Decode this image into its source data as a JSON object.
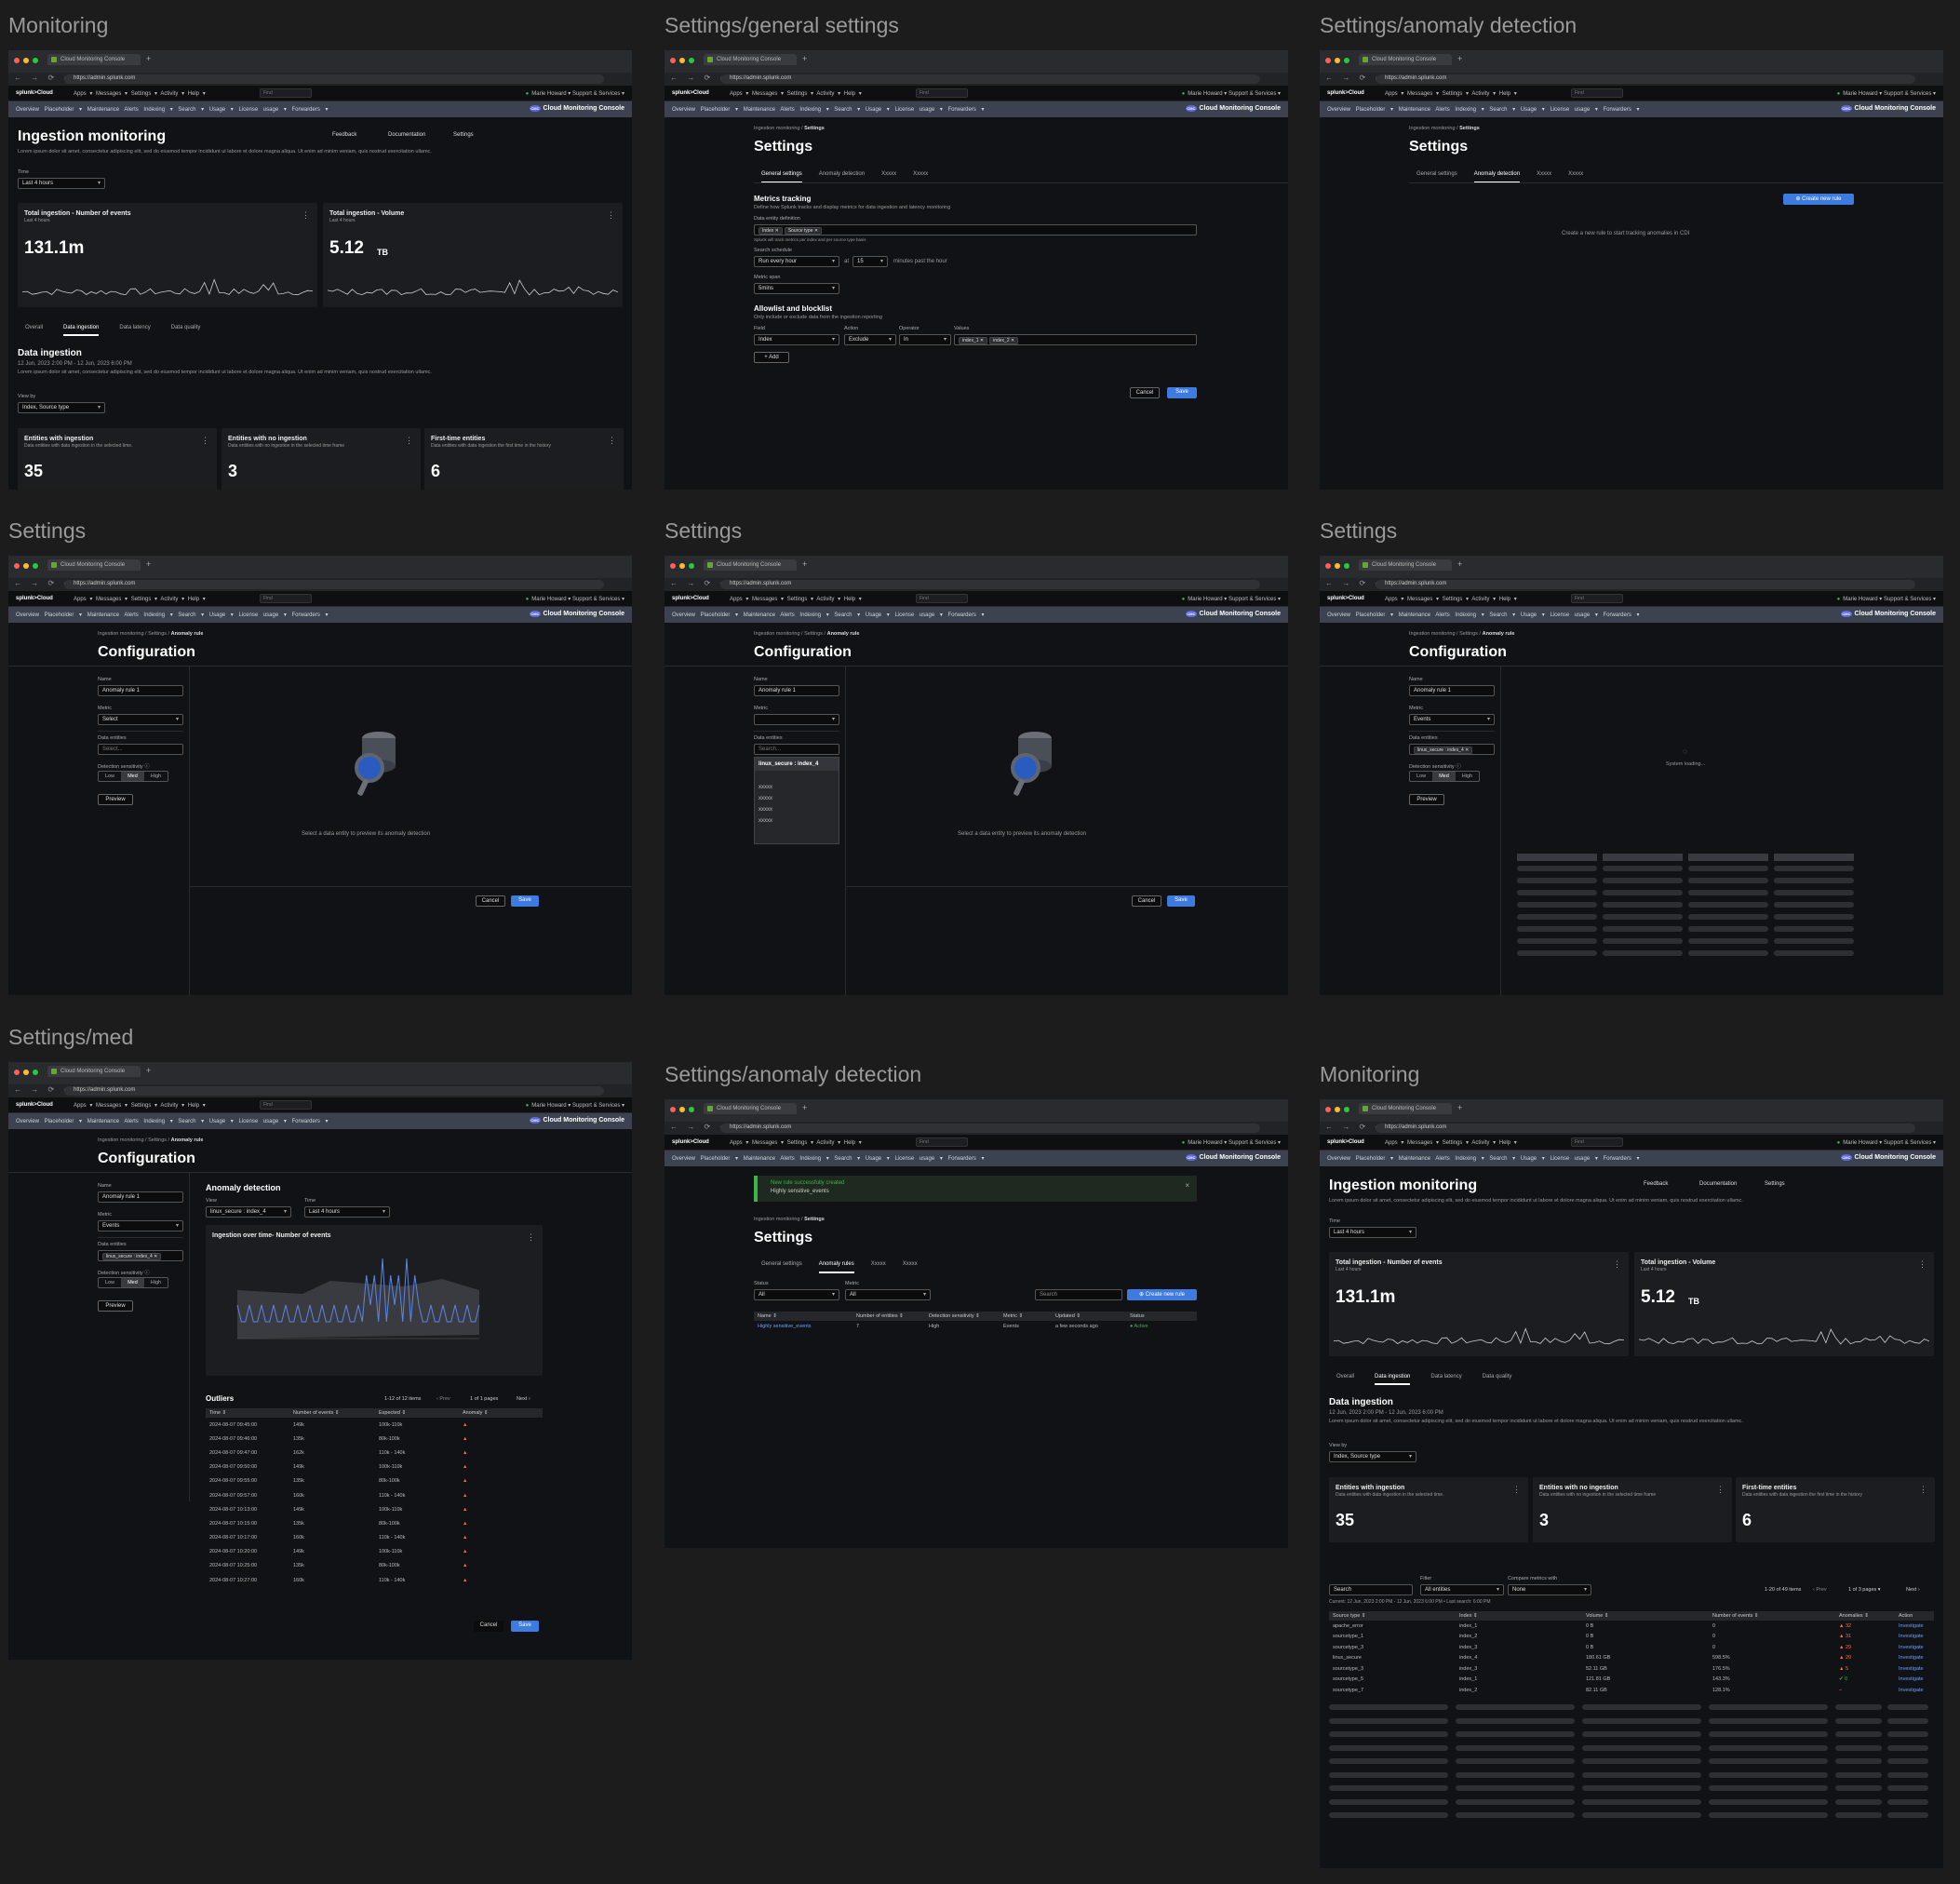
{
  "frame_titles": [
    "Monitoring",
    "Settings/general settings",
    "Settings/anomaly detection",
    "Settings",
    "Settings",
    "Settings",
    "Settings/med",
    "Settings/anomaly detection",
    "Monitoring"
  ],
  "browser": {
    "tab": "Cloud Monitoring Console",
    "url": "https://admin.splunk.com"
  },
  "appbar": {
    "logo": "splunk>Cloud",
    "menus": "Apps ▾  Messages ▾  Settings ▾  Activity ▾  Help ▾",
    "find": "Find",
    "user": "Marie Howard ▾   Support & Services ▾"
  },
  "subnav": {
    "items": "Overview   Placeholder ▾   Maintenance   Alerts   Indexing ▾   Search ▾   Usage ▾   License usage ▾   Forwarders ▾",
    "brand": "Cloud Monitoring Console"
  },
  "monitoring": {
    "title": "Ingestion monitoring",
    "actions": [
      "Feedback",
      "Documentation",
      "Settings"
    ],
    "desc": "Lorem ipsum dolor sit amet, consectetur adipiscing elit, sed do eiusmod tempor incididunt ut labore et dolore magna aliqua. Ut enim ad minim veniam, quis nostrud exercitation ullamc.",
    "time_label": "Time",
    "time_value": "Last 4 hours",
    "card1": {
      "title": "Total ingestion - Number of events",
      "sub": "Last 4 hours",
      "value": "131.1m"
    },
    "card2": {
      "title": "Total ingestion - Volume",
      "sub": "Last 4 hours",
      "value": "5.12",
      "unit": "TB"
    },
    "tabs": [
      "Overall",
      "Data ingestion",
      "Data latency",
      "Data quality"
    ],
    "section_title": "Data ingestion",
    "section_range": "12 Jun, 2023 2:00 PM - 12 Jun, 2023 6:00 PM",
    "section_desc": "Lorem ipsum dolor sit amet, consectetur adipiscing elit, sed do eiusmod tempor incididunt ut labore et dolore magna aliqua. Ut enim ad minim veniam, quis nostrud exercitation ullamc.",
    "view_by_label": "View by",
    "view_by": "Index, Source type",
    "stats": [
      {
        "title": "Entities with ingestion",
        "sub": "Data entities with data ingestion in the selected time.",
        "value": "35"
      },
      {
        "title": "Entities with no ingestion",
        "sub": "Data entities with no ingestion in the selected time frame",
        "value": "3"
      },
      {
        "title": "First-time entities",
        "sub": "Data entities with data ingestion the first time in the history",
        "value": "6"
      }
    ]
  },
  "general": {
    "crumb1": "Ingestion monitoring",
    "crumb2": "Settings",
    "title": "Settings",
    "tabs": [
      "General settings",
      "Anomaly detection",
      "Xxxxx",
      "Xxxxx"
    ],
    "metrics_title": "Metrics tracking",
    "metrics_desc": "Define how Splunk tracks and display metrics for data ingestion and latency monitoring",
    "entity_label": "Data entity definition",
    "entity_pills": [
      "Index ✕",
      "Source type ✕"
    ],
    "entity_help": "Splunk will track metrics per index and per source type basis",
    "schedule_label": "Search schedule",
    "schedule": "Run every hour",
    "at": "at",
    "minutes": "15",
    "past": "minutes past the hour",
    "span_label": "Metric span",
    "span": "5mins",
    "allow_title": "Allowlist and blocklist",
    "allow_desc": "Only include or exclude data from the ingestion reporting",
    "field_label": "Field",
    "field": "Index",
    "action_label": "Action",
    "action": "Exclude",
    "op_label": "Operator",
    "op": "In",
    "values_label": "Values",
    "values": [
      "index_1 ✕",
      "index_2 ✕"
    ],
    "add": "+ Add",
    "cancel": "Cancel",
    "save": "Save"
  },
  "anomaly_empty": {
    "create": "⊕ Create new rule",
    "empty": "Create a new rule to start tracking anomalies in CDI"
  },
  "config": {
    "crumb3": "Anomaly rule",
    "title": "Configuration",
    "name_label": "Name",
    "name": "Anomaly rule 1",
    "metric_label": "Metric",
    "metric_select": "Select",
    "metric_events": "Events",
    "entities_label": "Data entities",
    "entities_ph": "Select...",
    "entities_search": "Search...",
    "entity_sel": "linux_secure : index_4 ✕",
    "sens_label": "Detection sensitivity ⓘ",
    "sens": [
      "Low",
      "Med",
      "High"
    ],
    "preview": "Preview",
    "empty": "Select a data entity to preview its anomaly detection",
    "dropdown": [
      "linux_secure : index_4",
      "xxxxx",
      "xxxxx",
      "xxxxx",
      "xxxxx"
    ],
    "loading": "System loading..."
  },
  "med": {
    "panel_title": "Anomaly detection",
    "view_label": "View",
    "view": "linux_secure : index_4",
    "time_label": "Time",
    "time": "Last 4 hours",
    "chart_title": "Ingestion over time- Number of events",
    "outliers": "Outliers",
    "range": "1-12 of 12 items",
    "prev": "‹ Prev",
    "pages": "1 of 1 pages",
    "next": "Next ›",
    "cols": [
      "Time ⇕",
      "Number of events ⇕",
      "Expected ⇕",
      "Anomaly ⇕"
    ],
    "rows": [
      [
        "2024-08-07 09:45:00",
        "149k",
        "100k-110k"
      ],
      [
        "2024-08-07 09:46:00",
        "135k",
        "80k-100k"
      ],
      [
        "2024-08-07 09:47:00",
        "162k",
        "110k - 140k"
      ],
      [
        "2024-08-07 09:50:00",
        "149k",
        "100k-110k"
      ],
      [
        "2024-08-07 09:55:00",
        "135k",
        "80k-100k"
      ],
      [
        "2024-08-07 09:57:00",
        "160k",
        "110k - 140k"
      ],
      [
        "2024-08-07 10:13:00",
        "149k",
        "100k-110k"
      ],
      [
        "2024-08-07 10:15:00",
        "135k",
        "80k-100k"
      ],
      [
        "2024-08-07 10:17:00",
        "160k",
        "110k - 140k"
      ],
      [
        "2024-08-07 10:20:00",
        "149k",
        "100k-110k"
      ],
      [
        "2024-08-07 10:25:00",
        "135k",
        "80k-100k"
      ],
      [
        "2024-08-07 10:27:00",
        "160k",
        "110k - 140k"
      ]
    ],
    "cancel": "Cancel",
    "save": "Save"
  },
  "rules": {
    "toast_title": "New rule successfully created",
    "toast_sub": "Highly sensitive_events",
    "tabs": [
      "General settings",
      "Anomaly rules",
      "Xxxxx",
      "Xxxxx"
    ],
    "status_label": "Status",
    "status": "All",
    "metric_label": "Metric",
    "metric": "All",
    "search": "Search",
    "create": "⊕ Create new rule",
    "cols": [
      "Name ⇕",
      "Number of entities ⇕",
      "Detection sensitivity ⇕",
      "Metric ⇕",
      "Updated ⇕",
      "Status"
    ],
    "row": [
      "Highly sensitive_events",
      "7",
      "High",
      "Events",
      "a few seconds ago",
      "● Active"
    ]
  },
  "monitor2": {
    "filter_label": "Filter",
    "filter": "All entities",
    "compare_label": "Compare metrics with",
    "compare": "None",
    "search": "Search",
    "range": "1-20 of 49 items",
    "prev": "‹ Prev",
    "pages": "1 of 3 pages ▾",
    "next": "Next ›",
    "current": "Current: 12 Jun, 2023 2:00 PM - 12 Jun, 2023 6:00 PM • Last search: 6:00 PM",
    "cols": [
      "Source type ⇕",
      "Index ⇕",
      "Volume ⇕",
      "Number of events ⇕",
      "Anomalies ⇕",
      "Action"
    ],
    "rows": [
      [
        "apache_error",
        "index_1",
        "0 B",
        "0",
        "▲ 32"
      ],
      [
        "sourcetype_1",
        "index_2",
        "0 B",
        "0",
        "▲ 31"
      ],
      [
        "sourcetype_3",
        "index_3",
        "0 B",
        "0",
        "▲ 29"
      ],
      [
        "linux_secure",
        "index_4",
        "180.61 GB",
        "598.5%",
        "▲ 20"
      ],
      [
        "sourcetype_3",
        "index_3",
        "52.11 GB",
        "176.5%",
        "▲ 5"
      ],
      [
        "sourcetype_5",
        "index_1",
        "121.81 GB",
        "143.3%",
        "✔ 0"
      ],
      [
        "sourcetype_7",
        "index_2",
        "82.11 GB",
        "128.1%",
        "–"
      ]
    ],
    "action": "Investigate"
  },
  "colors": {
    "accent": "#3d7be0",
    "success": "#3cb44b",
    "warning": "#ff6a3d",
    "bg": "#111215"
  }
}
